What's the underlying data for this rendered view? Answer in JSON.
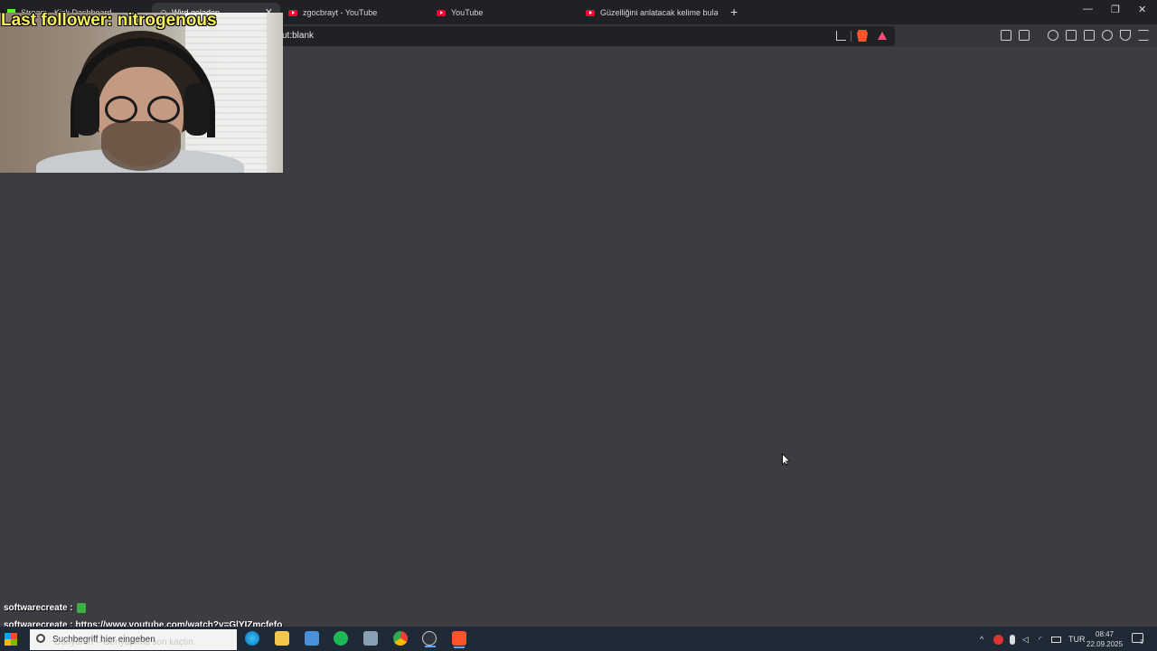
{
  "browser": {
    "tabs": [
      {
        "title": "Stream - Kick Dashboard"
      },
      {
        "title": "Wird geladen...",
        "active": true
      },
      {
        "title": "zgocbrayt - YouTube"
      },
      {
        "title": "YouTube"
      },
      {
        "title": "Güzelliğini anlatacak kelime bulamadı"
      }
    ],
    "new_tab": "+",
    "address": "ut:blank",
    "window_controls": {
      "minimize": "—",
      "restore": "❐",
      "close": "✕"
    }
  },
  "overlay": {
    "last_follower": "Last follower: nitrogenous",
    "chat": [
      {
        "user": "softwarecreate",
        "sep": " :",
        "message": ""
      },
      {
        "user": "softwarecreate",
        "sep": " :",
        "message": " https://www.youtube.com/watch?v=GlYIZmcfefo"
      }
    ]
  },
  "taskbar": {
    "search_placeholder": "Suchbegriff hier eingeben",
    "search_overlay": "Dünyanın – Geriyapıma son kaçtın",
    "tray_lang": "TUR",
    "clock_time": "08:47",
    "clock_date": "22.09.2025",
    "notification_count": "1"
  },
  "colors": {
    "page_bg": "#3c3c42",
    "follower_text": "#f7f15a",
    "youtube_red": "#ff0033"
  }
}
